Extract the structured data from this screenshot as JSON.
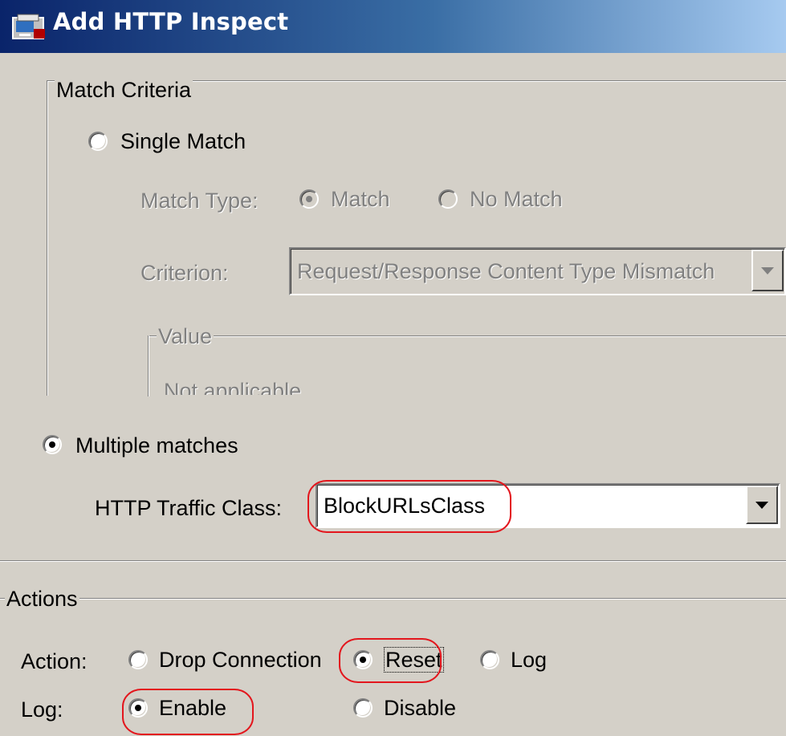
{
  "window": {
    "title": "Add HTTP Inspect",
    "icon": "app-window-icon"
  },
  "match_criteria": {
    "legend": "Match Criteria",
    "single_match": {
      "label": "Single Match",
      "selected": false
    },
    "match_type": {
      "label": "Match Type:",
      "options": [
        {
          "label": "Match",
          "selected": true
        },
        {
          "label": "No Match",
          "selected": false
        }
      ]
    },
    "criterion": {
      "label": "Criterion:",
      "value": "Request/Response Content Type Mismatch"
    },
    "value_group": {
      "legend": "Value",
      "text": "Not applicable"
    },
    "multiple_matches": {
      "label": "Multiple matches",
      "selected": true
    },
    "http_traffic_class": {
      "label": "HTTP Traffic Class:",
      "value": "BlockURLsClass"
    }
  },
  "actions": {
    "legend": "Actions",
    "action": {
      "label": "Action:",
      "options": [
        {
          "label": "Drop Connection",
          "selected": false
        },
        {
          "label": "Reset",
          "selected": true
        },
        {
          "label": "Log",
          "selected": false
        }
      ]
    },
    "log": {
      "label": "Log:",
      "options": [
        {
          "label": "Enable",
          "selected": true
        },
        {
          "label": "Disable",
          "selected": false
        }
      ]
    }
  },
  "colors": {
    "dialog_bg": "#d4d0c8",
    "titlebar_start": "#0a246a",
    "titlebar_end": "#a6caf0",
    "highlight_circle": "#e3161d"
  }
}
